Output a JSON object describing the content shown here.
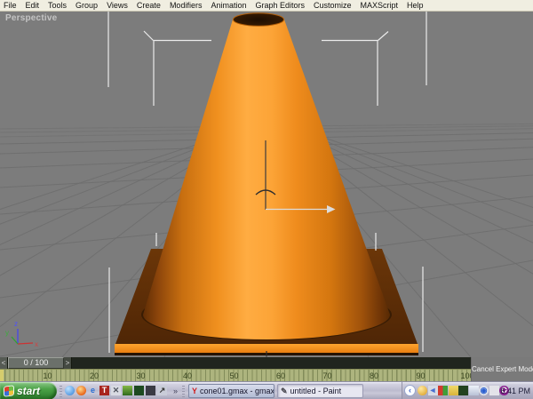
{
  "menu_bar": {
    "items": [
      "File",
      "Edit",
      "Tools",
      "Group",
      "Views",
      "Create",
      "Modifiers",
      "Animation",
      "Graph Editors",
      "Customize",
      "MAXScript",
      "Help"
    ]
  },
  "viewport": {
    "label": "Perspective",
    "scene_object": "orange traffic cone on square base, selected, with move gizmo",
    "axis": {
      "x": "x",
      "y": "y",
      "z": "z"
    }
  },
  "timeline": {
    "prev_label": "<",
    "slider_value": "0 / 100",
    "next_label": ">",
    "ruler_numbers": [
      "10",
      "20",
      "30",
      "40",
      "50",
      "60",
      "70",
      "80",
      "90",
      "100"
    ],
    "cancel_button": "Cancel Expert Mode"
  },
  "taskbar": {
    "start_label": "start",
    "overflow_glyph": "»",
    "tray_chevron": "‹",
    "clock": "6:41 PM",
    "quick_launch": [
      {
        "name": "messenger-icon",
        "glyph": "",
        "fg": "#ffffff",
        "bg": "radial-gradient(circle at 35% 30%, #bfe3ff, #2f7fd6)",
        "round": true
      },
      {
        "name": "firefox-icon",
        "glyph": "",
        "fg": "#ffffff",
        "bg": "radial-gradient(circle at 40% 35%, #ffd98a, #e8661a 70%, #b34708)",
        "round": true
      },
      {
        "name": "internet-explorer-icon",
        "glyph": "e",
        "fg": "#2a6fd4",
        "bg": "transparent",
        "round": false
      },
      {
        "name": "textpad-icon",
        "glyph": "T",
        "fg": "#ffffff",
        "bg": "#a8241e",
        "round": false
      },
      {
        "name": "tools-icon",
        "glyph": "✕",
        "fg": "#50555f",
        "bg": "#d8dae2",
        "round": false
      },
      {
        "name": "grass-app-icon",
        "glyph": "",
        "fg": "#ffffff",
        "bg": "linear-gradient(#86b848,#2f6a1d)",
        "round": false
      },
      {
        "name": "dark-green-app-icon",
        "glyph": "",
        "fg": "#ffffff",
        "bg": "#1d4a20",
        "round": false
      },
      {
        "name": "console-icon",
        "glyph": "",
        "fg": "#ffffff",
        "bg": "#3a3a44",
        "round": false
      },
      {
        "name": "show-desktop-icon",
        "glyph": "↗",
        "fg": "#333333",
        "bg": "#c9ccd8",
        "round": false
      }
    ],
    "windows": [
      {
        "label": "cone01.gmax - gmax",
        "icon_glyph": "Y",
        "icon_color": "#cf1f1f",
        "active": false
      },
      {
        "label": "untitled - Paint",
        "icon_glyph": "✎",
        "icon_color": "#4a4a52",
        "active": true
      }
    ],
    "tray": [
      {
        "name": "tray-update-icon",
        "glyph": "",
        "fg": "#ffffff",
        "bg": "radial-gradient(circle at 35% 30%, #ffe9a0, #d89a1b)",
        "round": true
      },
      {
        "name": "tray-volume-icon",
        "glyph": "◄",
        "fg": "#4a6fd0",
        "bg": "#d7dbe4",
        "round": false
      },
      {
        "name": "tray-messenger-icon",
        "glyph": "",
        "fg": "#ffffff",
        "bg": "linear-gradient(90deg,#d23b2f 50%,#3f9e3a 50%)",
        "round": false
      },
      {
        "name": "tray-folder-icon",
        "glyph": "",
        "fg": "#ffffff",
        "bg": "linear-gradient(#efd96a,#d9b43a)",
        "round": false
      },
      {
        "name": "tray-network-icon",
        "glyph": "",
        "fg": "#9fd08a",
        "bg": "#23421f",
        "round": false
      },
      {
        "name": "tray-display-icon",
        "glyph": "",
        "fg": "#45517a",
        "bg": "linear-gradient(#eef2fa,#b9c2d6)",
        "round": false
      },
      {
        "name": "tray-search-icon",
        "glyph": "◉",
        "fg": "#2a5fd0",
        "bg": "#dde1ea",
        "round": true
      },
      {
        "name": "tray-generic-icon",
        "glyph": "",
        "fg": "#666666",
        "bg": "#e3e3e9",
        "round": false
      },
      {
        "name": "tray-opera-icon",
        "glyph": "O",
        "fg": "#ffffff",
        "bg": "#8a1f8f",
        "round": true
      }
    ]
  },
  "colors": {
    "viewport_grey": "#7c7c7c",
    "grid_line": "#6d6d6d",
    "cone_orange": "#f5921e",
    "cone_highlight": "#ffac42",
    "base_brown": "#5e2f06",
    "base_edge_orange": "#f7941d",
    "selection_bracket_white": "#ebebeb",
    "ruler_olive": "#adb47e",
    "track_dark": "#20251e",
    "taskbar_silver": "#bcbbce",
    "start_green": "#4aa246"
  }
}
